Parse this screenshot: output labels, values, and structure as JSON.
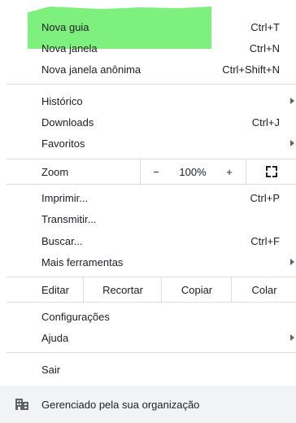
{
  "menu": {
    "group1": [
      {
        "label": "Nova guia",
        "shortcut": "Ctrl+T"
      },
      {
        "label": "Nova janela",
        "shortcut": "Ctrl+N"
      },
      {
        "label": "Nova janela anônima",
        "shortcut": "Ctrl+Shift+N"
      }
    ],
    "group2": [
      {
        "label": "Histórico",
        "submenu": true
      },
      {
        "label": "Downloads",
        "shortcut": "Ctrl+J"
      },
      {
        "label": "Favoritos",
        "submenu": true
      }
    ],
    "zoom": {
      "label": "Zoom",
      "minus": "−",
      "value": "100%",
      "plus": "+",
      "fullscreen_icon": "fullscreen-icon"
    },
    "group3": [
      {
        "label": "Imprimir...",
        "shortcut": "Ctrl+P"
      },
      {
        "label": "Transmitir..."
      },
      {
        "label": "Buscar...",
        "shortcut": "Ctrl+F"
      },
      {
        "label": "Mais ferramentas",
        "submenu": true
      }
    ],
    "edit": {
      "label": "Editar",
      "cut": "Recortar",
      "copy": "Copiar",
      "paste": "Colar"
    },
    "group4": [
      {
        "label": "Configurações"
      },
      {
        "label": "Ajuda",
        "submenu": true
      }
    ],
    "exit": {
      "label": "Sair"
    },
    "footer": {
      "label": "Gerenciado pela sua organização",
      "icon": "building-icon"
    }
  },
  "colors": {
    "highlight": "#7ef07e",
    "separator": "#dadce0",
    "footer_bg": "#f1f3f4"
  }
}
